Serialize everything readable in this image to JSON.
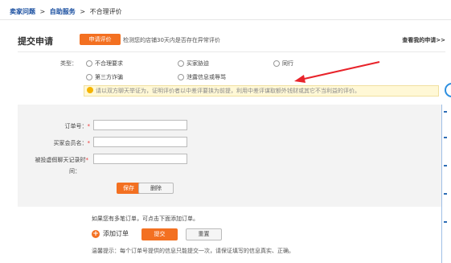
{
  "breadcrumb": {
    "item1": "卖家问题",
    "sep1": ">",
    "item2": "自助服务",
    "sep2": ">",
    "current": "不合理评价"
  },
  "panel": {
    "title": "提交申请",
    "head_button": "申请评价",
    "head_hint": "检测您的店铺30天内是否存在异常评价",
    "head_link": "查看我的申请>>"
  },
  "type": {
    "label": "类型：",
    "options": [
      "不合理要求",
      "买家胁迫",
      "同行",
      "第三方诈骗",
      "泄露信息或辱骂"
    ]
  },
  "notice": "请以双方聊天举证为，证明评价者以中差评要挟为前提，利用中差评谋取额外钱财或其它不当利益的评价。",
  "form": {
    "order_label": "订单号：",
    "buyer_label": "买家会员名：",
    "time_label_1": "被投虚假聊天记录时",
    "time_label_2": "间：",
    "required_mark": "*",
    "save": "保存",
    "reset": "删除"
  },
  "footer": {
    "multi_hint": "如果您有多笔订单，可点击下面添加订单。",
    "add_order": "添加订单",
    "submit": "提交",
    "clear": "重置",
    "tip": "温馨提示：每个订单号提供的信息只能提交一次，请保证填写的信息真实、正确。"
  },
  "colors": {
    "accent": "#f37021",
    "link": "#1a4fa0",
    "arrow": "#e8232a"
  }
}
